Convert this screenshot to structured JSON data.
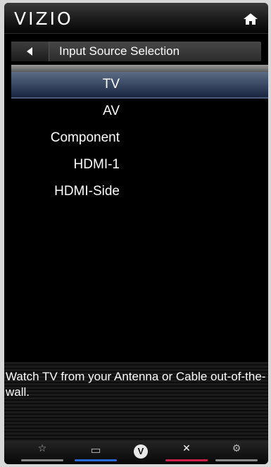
{
  "header": {
    "brand": "VIZIO",
    "home_icon": "home-icon"
  },
  "titlebar": {
    "back_icon": "back-arrow-icon",
    "title": "Input Source Selection"
  },
  "inputs": {
    "items": [
      {
        "label": "TV",
        "selected": true
      },
      {
        "label": "AV",
        "selected": false
      },
      {
        "label": "Component",
        "selected": false
      },
      {
        "label": "HDMI-1",
        "selected": false
      },
      {
        "label": "HDMI-Side",
        "selected": false
      }
    ]
  },
  "description": "Watch TV from your Antenna or Cable out-of-the-wall.",
  "bottom_bar": {
    "buttons": [
      {
        "name": "favorites-button",
        "icon": "star-icon",
        "glyph": "☆",
        "accent": "#8a8a8a"
      },
      {
        "name": "widescreen-button",
        "icon": "widescreen-icon",
        "glyph": "▭",
        "accent": "#2a6ad8"
      },
      {
        "name": "vizio-button",
        "icon": "vizio-v-icon",
        "glyph": "V",
        "accent": ""
      },
      {
        "name": "close-button",
        "icon": "close-icon",
        "glyph": "✕",
        "accent": "#d0204a"
      },
      {
        "name": "settings-button",
        "icon": "gear-icon",
        "glyph": "⚙",
        "accent": "#8a8a8a"
      }
    ]
  },
  "colors": {
    "selected_row": "#2c3a56",
    "background": "#000000"
  }
}
